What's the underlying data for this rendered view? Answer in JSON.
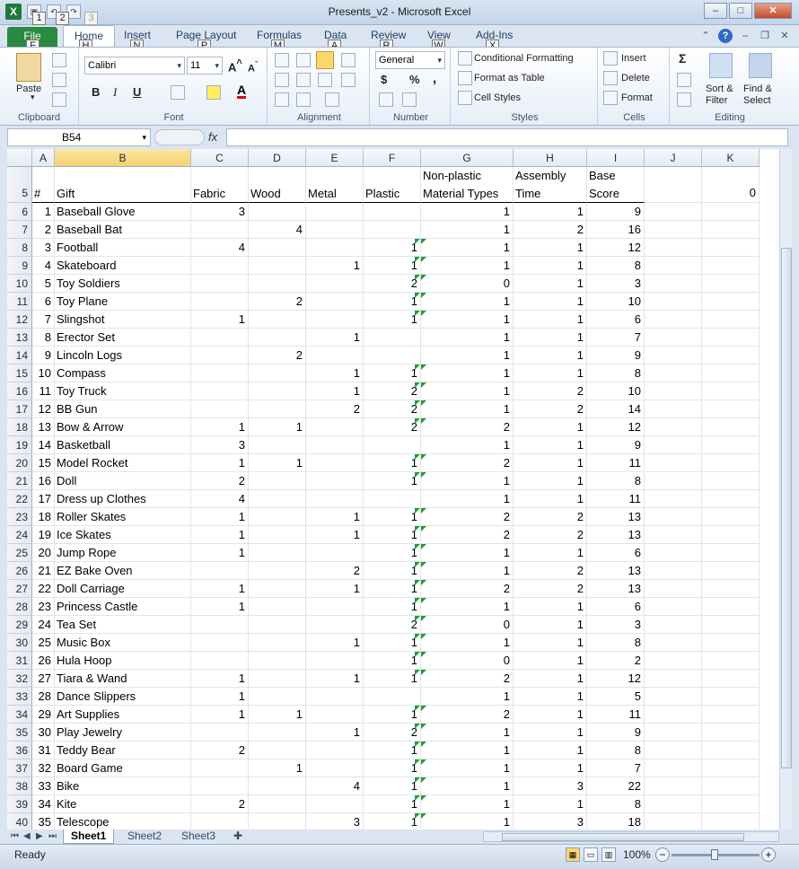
{
  "window": {
    "title": "Presents_v2  -  Microsoft Excel",
    "minimize": "–",
    "maximize": "□",
    "close": "✕"
  },
  "qat": {
    "app_icon": "X",
    "keytips": [
      "1",
      "2",
      "3"
    ]
  },
  "ribbon_tabs": [
    {
      "label": "File",
      "keytip": "F"
    },
    {
      "label": "Home",
      "keytip": "H"
    },
    {
      "label": "Insert",
      "keytip": "N"
    },
    {
      "label": "Page Layout",
      "keytip": "P"
    },
    {
      "label": "Formulas",
      "keytip": "M"
    },
    {
      "label": "Data",
      "keytip": "A"
    },
    {
      "label": "Review",
      "keytip": "R"
    },
    {
      "label": "View",
      "keytip": "W"
    },
    {
      "label": "Add-Ins",
      "keytip": "X"
    }
  ],
  "ribbon": {
    "clipboard": {
      "label": "Clipboard",
      "paste": "Paste"
    },
    "font": {
      "label": "Font",
      "name": "Calibri",
      "size": "11",
      "bold": "B",
      "italic": "I",
      "underline": "U"
    },
    "alignment": {
      "label": "Alignment"
    },
    "number": {
      "label": "Number",
      "format": "General",
      "currency": "$",
      "percent": "%",
      "comma": ","
    },
    "styles": {
      "label": "Styles",
      "conditional": "Conditional Formatting",
      "format_table": "Format as Table",
      "cell_styles": "Cell Styles"
    },
    "cells": {
      "label": "Cells",
      "insert": "Insert",
      "delete": "Delete",
      "format": "Format"
    },
    "editing": {
      "label": "Editing",
      "sum": "Σ",
      "sort": "Sort &",
      "filter": "Filter",
      "find": "Find &",
      "select": "Select"
    }
  },
  "formula_bar": {
    "name_box": "B54",
    "fx": "fx",
    "formula": ""
  },
  "columns": [
    "A",
    "B",
    "C",
    "D",
    "E",
    "F",
    "G",
    "H",
    "I",
    "J",
    "K"
  ],
  "headers": {
    "row_num": "5",
    "num": "#",
    "gift": "Gift",
    "fabric": "Fabric",
    "wood": "Wood",
    "metal": "Metal",
    "plastic": "Plastic",
    "nonplastic_1": "Non-plastic",
    "nonplastic_2": "Material Types",
    "assembly_1": "Assembly",
    "assembly_2": "Time",
    "base_1": "Base",
    "base_2": "Score",
    "k_value": "0"
  },
  "rows": [
    {
      "r": "6",
      "n": "1",
      "gift": "Baseball Glove",
      "fabric": "3",
      "wood": "",
      "metal": "",
      "plastic": "",
      "np": "1",
      "at": "1",
      "bs": "9"
    },
    {
      "r": "7",
      "n": "2",
      "gift": "Baseball Bat",
      "fabric": "",
      "wood": "4",
      "metal": "",
      "plastic": "",
      "np": "1",
      "at": "2",
      "bs": "16"
    },
    {
      "r": "8",
      "n": "3",
      "gift": "Football",
      "fabric": "4",
      "wood": "",
      "metal": "",
      "plastic": "1",
      "np": "1",
      "at": "1",
      "bs": "12"
    },
    {
      "r": "9",
      "n": "4",
      "gift": "Skateboard",
      "fabric": "",
      "wood": "",
      "metal": "1",
      "plastic": "1",
      "np": "1",
      "at": "1",
      "bs": "8"
    },
    {
      "r": "10",
      "n": "5",
      "gift": "Toy Soldiers",
      "fabric": "",
      "wood": "",
      "metal": "",
      "plastic": "2",
      "np": "0",
      "at": "1",
      "bs": "3"
    },
    {
      "r": "11",
      "n": "6",
      "gift": "Toy Plane",
      "fabric": "",
      "wood": "2",
      "metal": "",
      "plastic": "1",
      "np": "1",
      "at": "1",
      "bs": "10"
    },
    {
      "r": "12",
      "n": "7",
      "gift": "Slingshot",
      "fabric": "1",
      "wood": "",
      "metal": "",
      "plastic": "1",
      "np": "1",
      "at": "1",
      "bs": "6"
    },
    {
      "r": "13",
      "n": "8",
      "gift": "Erector Set",
      "fabric": "",
      "wood": "",
      "metal": "1",
      "plastic": "",
      "np": "1",
      "at": "1",
      "bs": "7"
    },
    {
      "r": "14",
      "n": "9",
      "gift": "Lincoln Logs",
      "fabric": "",
      "wood": "2",
      "metal": "",
      "plastic": "",
      "np": "1",
      "at": "1",
      "bs": "9"
    },
    {
      "r": "15",
      "n": "10",
      "gift": "Compass",
      "fabric": "",
      "wood": "",
      "metal": "1",
      "plastic": "1",
      "np": "1",
      "at": "1",
      "bs": "8"
    },
    {
      "r": "16",
      "n": "11",
      "gift": "Toy Truck",
      "fabric": "",
      "wood": "",
      "metal": "1",
      "plastic": "2",
      "np": "1",
      "at": "2",
      "bs": "10"
    },
    {
      "r": "17",
      "n": "12",
      "gift": "BB Gun",
      "fabric": "",
      "wood": "",
      "metal": "2",
      "plastic": "2",
      "np": "1",
      "at": "2",
      "bs": "14"
    },
    {
      "r": "18",
      "n": "13",
      "gift": "Bow & Arrow",
      "fabric": "1",
      "wood": "1",
      "metal": "",
      "plastic": "2",
      "np": "2",
      "at": "1",
      "bs": "12"
    },
    {
      "r": "19",
      "n": "14",
      "gift": "Basketball",
      "fabric": "3",
      "wood": "",
      "metal": "",
      "plastic": "",
      "np": "1",
      "at": "1",
      "bs": "9"
    },
    {
      "r": "20",
      "n": "15",
      "gift": "Model Rocket",
      "fabric": "1",
      "wood": "1",
      "metal": "",
      "plastic": "1",
      "np": "2",
      "at": "1",
      "bs": "11"
    },
    {
      "r": "21",
      "n": "16",
      "gift": "Doll",
      "fabric": "2",
      "wood": "",
      "metal": "",
      "plastic": "1",
      "np": "1",
      "at": "1",
      "bs": "8"
    },
    {
      "r": "22",
      "n": "17",
      "gift": "Dress up Clothes",
      "fabric": "4",
      "wood": "",
      "metal": "",
      "plastic": "",
      "np": "1",
      "at": "1",
      "bs": "11"
    },
    {
      "r": "23",
      "n": "18",
      "gift": "Roller Skates",
      "fabric": "1",
      "wood": "",
      "metal": "1",
      "plastic": "1",
      "np": "2",
      "at": "2",
      "bs": "13"
    },
    {
      "r": "24",
      "n": "19",
      "gift": "Ice Skates",
      "fabric": "1",
      "wood": "",
      "metal": "1",
      "plastic": "1",
      "np": "2",
      "at": "2",
      "bs": "13"
    },
    {
      "r": "25",
      "n": "20",
      "gift": "Jump Rope",
      "fabric": "1",
      "wood": "",
      "metal": "",
      "plastic": "1",
      "np": "1",
      "at": "1",
      "bs": "6"
    },
    {
      "r": "26",
      "n": "21",
      "gift": "EZ Bake Oven",
      "fabric": "",
      "wood": "",
      "metal": "2",
      "plastic": "1",
      "np": "1",
      "at": "2",
      "bs": "13"
    },
    {
      "r": "27",
      "n": "22",
      "gift": "Doll Carriage",
      "fabric": "1",
      "wood": "",
      "metal": "1",
      "plastic": "1",
      "np": "2",
      "at": "2",
      "bs": "13"
    },
    {
      "r": "28",
      "n": "23",
      "gift": "Princess Castle",
      "fabric": "1",
      "wood": "",
      "metal": "",
      "plastic": "1",
      "np": "1",
      "at": "1",
      "bs": "6"
    },
    {
      "r": "29",
      "n": "24",
      "gift": "Tea Set",
      "fabric": "",
      "wood": "",
      "metal": "",
      "plastic": "2",
      "np": "0",
      "at": "1",
      "bs": "3"
    },
    {
      "r": "30",
      "n": "25",
      "gift": "Music Box",
      "fabric": "",
      "wood": "",
      "metal": "1",
      "plastic": "1",
      "np": "1",
      "at": "1",
      "bs": "8"
    },
    {
      "r": "31",
      "n": "26",
      "gift": "Hula Hoop",
      "fabric": "",
      "wood": "",
      "metal": "",
      "plastic": "1",
      "np": "0",
      "at": "1",
      "bs": "2"
    },
    {
      "r": "32",
      "n": "27",
      "gift": "Tiara & Wand",
      "fabric": "1",
      "wood": "",
      "metal": "1",
      "plastic": "1",
      "np": "2",
      "at": "1",
      "bs": "12"
    },
    {
      "r": "33",
      "n": "28",
      "gift": "Dance Slippers",
      "fabric": "1",
      "wood": "",
      "metal": "",
      "plastic": "",
      "np": "1",
      "at": "1",
      "bs": "5"
    },
    {
      "r": "34",
      "n": "29",
      "gift": "Art Supplies",
      "fabric": "1",
      "wood": "1",
      "metal": "",
      "plastic": "1",
      "np": "2",
      "at": "1",
      "bs": "11"
    },
    {
      "r": "35",
      "n": "30",
      "gift": "Play Jewelry",
      "fabric": "",
      "wood": "",
      "metal": "1",
      "plastic": "2",
      "np": "1",
      "at": "1",
      "bs": "9"
    },
    {
      "r": "36",
      "n": "31",
      "gift": "Teddy Bear",
      "fabric": "2",
      "wood": "",
      "metal": "",
      "plastic": "1",
      "np": "1",
      "at": "1",
      "bs": "8"
    },
    {
      "r": "37",
      "n": "32",
      "gift": "Board Game",
      "fabric": "",
      "wood": "1",
      "metal": "",
      "plastic": "1",
      "np": "1",
      "at": "1",
      "bs": "7"
    },
    {
      "r": "38",
      "n": "33",
      "gift": "Bike",
      "fabric": "",
      "wood": "",
      "metal": "4",
      "plastic": "1",
      "np": "1",
      "at": "3",
      "bs": "22"
    },
    {
      "r": "39",
      "n": "34",
      "gift": "Kite",
      "fabric": "2",
      "wood": "",
      "metal": "",
      "plastic": "1",
      "np": "1",
      "at": "1",
      "bs": "8"
    },
    {
      "r": "40",
      "n": "35",
      "gift": "Telescope",
      "fabric": "",
      "wood": "",
      "metal": "3",
      "plastic": "1",
      "np": "1",
      "at": "3",
      "bs": "18"
    }
  ],
  "sheets": [
    "Sheet1",
    "Sheet2",
    "Sheet3"
  ],
  "status": {
    "ready": "Ready",
    "zoom": "100%",
    "zoom_out": "−",
    "zoom_in": "+"
  }
}
